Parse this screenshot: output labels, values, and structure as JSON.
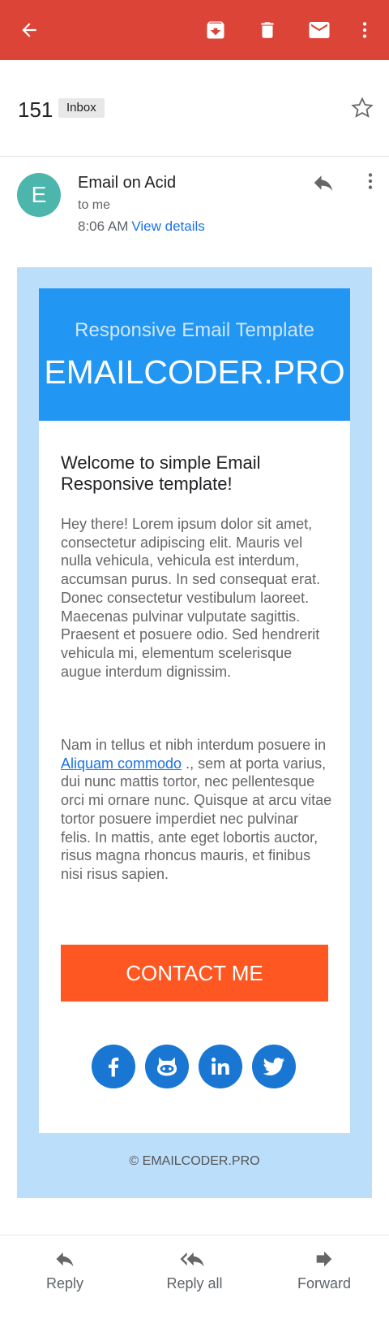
{
  "colors": {
    "appbar": "#dc4437",
    "avatar": "#4db6ac",
    "email_bg": "#bbdefb",
    "header_bg": "#2196f3",
    "cta_bg": "#ff5722",
    "social_bg": "#1976d2",
    "link": "#1a73e8"
  },
  "appbar": {
    "icons": [
      "back-arrow-icon",
      "archive-icon",
      "delete-icon",
      "mark-unread-icon",
      "more-vert-icon"
    ]
  },
  "message": {
    "count": "151",
    "label": "Inbox",
    "sender_initial": "E",
    "sender_name": "Email on Acid",
    "recipient": "to me",
    "time": "8:06 AM",
    "view_details": "View details"
  },
  "email": {
    "header_subtitle": "Responsive Email Template",
    "header_title": "EMAILCODER.PRO",
    "welcome": "Welcome to simple Email Responsive template!",
    "paragraph1": "Hey there! Lorem ipsum dolor sit amet, consectetur adipiscing elit. Mauris vel nulla vehicula, vehicula est interdum, accumsan purus. In sed consequat erat. Donec consectetur vestibulum laoreet. Maecenas pulvinar vulputate sagittis. Praesent et posuere odio. Sed hendrerit vehicula mi, elementum scelerisque augue interdum dignissim.",
    "paragraph2_before": "Nam in tellus et nibh interdum posuere in ",
    "paragraph2_link": "Aliquam commodo",
    "paragraph2_after": " ., sem at porta varius, dui nunc mattis tortor, nec pellentesque orci mi ornare nunc. Quisque at arcu vitae tortor posuere imperdiet nec pulvinar felis. In mattis, ante eget lobortis auctor, risus magna rhoncus mauris, et finibus nisi risus sapien.",
    "cta_label": "CONTACT ME",
    "social": [
      "facebook-icon",
      "github-icon",
      "linkedin-icon",
      "twitter-icon"
    ],
    "footer": "© EMAILCODER.PRO"
  },
  "actions": {
    "reply": "Reply",
    "reply_all": "Reply all",
    "forward": "Forward"
  }
}
